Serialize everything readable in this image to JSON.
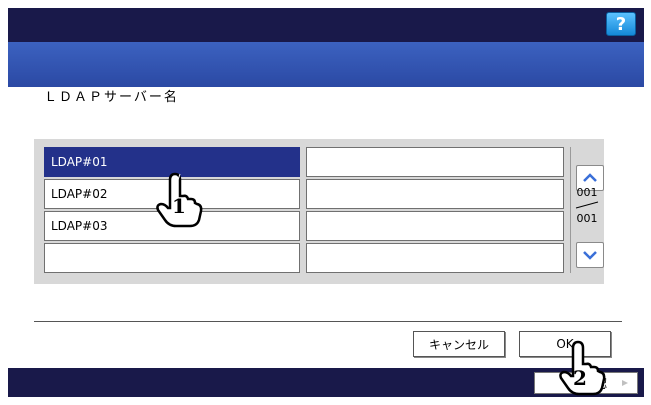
{
  "header": {
    "help_label": "?"
  },
  "dialog": {
    "title": "ＬＤＡＰサーバー名"
  },
  "list": {
    "left_items": [
      "LDAP#01",
      "LDAP#02",
      "LDAP#03",
      ""
    ],
    "right_items": [
      "",
      "",
      "",
      ""
    ],
    "selected_index": 0
  },
  "pager": {
    "current": "001",
    "total": "001"
  },
  "buttons": {
    "cancel_label": "キャンセル",
    "ok_label": "OK"
  },
  "footer": {
    "confirm_label": "認"
  },
  "callouts": {
    "step1": "1",
    "step2": "2"
  }
}
